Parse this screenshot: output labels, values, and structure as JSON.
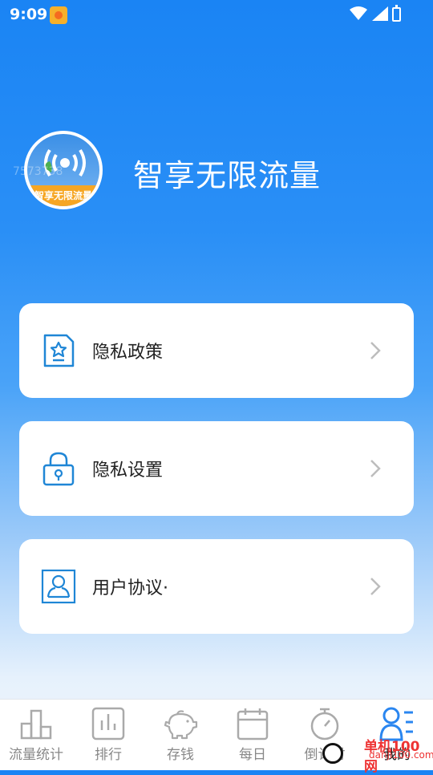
{
  "status_bar": {
    "time": "9:09"
  },
  "profile": {
    "avatar_ribbon": "智享无限流量",
    "watermark": "7573738",
    "title": "智享无限流量"
  },
  "menu": [
    {
      "label": "隐私政策",
      "icon": "document-star-icon"
    },
    {
      "label": "隐私设置",
      "icon": "lock-icon"
    },
    {
      "label": "用户协议·",
      "icon": "user-card-icon"
    }
  ],
  "tabs": [
    {
      "label": "流量统计",
      "icon": "bar-chart-icon"
    },
    {
      "label": "排行",
      "icon": "ranking-icon"
    },
    {
      "label": "存钱",
      "icon": "piggy-bank-icon"
    },
    {
      "label": "每日",
      "icon": "calendar-icon"
    },
    {
      "label": "倒计时",
      "icon": "stopwatch-icon"
    },
    {
      "label": "我的",
      "icon": "profile-list-icon",
      "active": true
    }
  ],
  "brand_watermark": {
    "text": "单机100网",
    "url": "danji100.com"
  },
  "colors": {
    "primary": "#1a84f4",
    "icon_blue": "#1f86d6",
    "active_tab": "#2a86f0"
  }
}
